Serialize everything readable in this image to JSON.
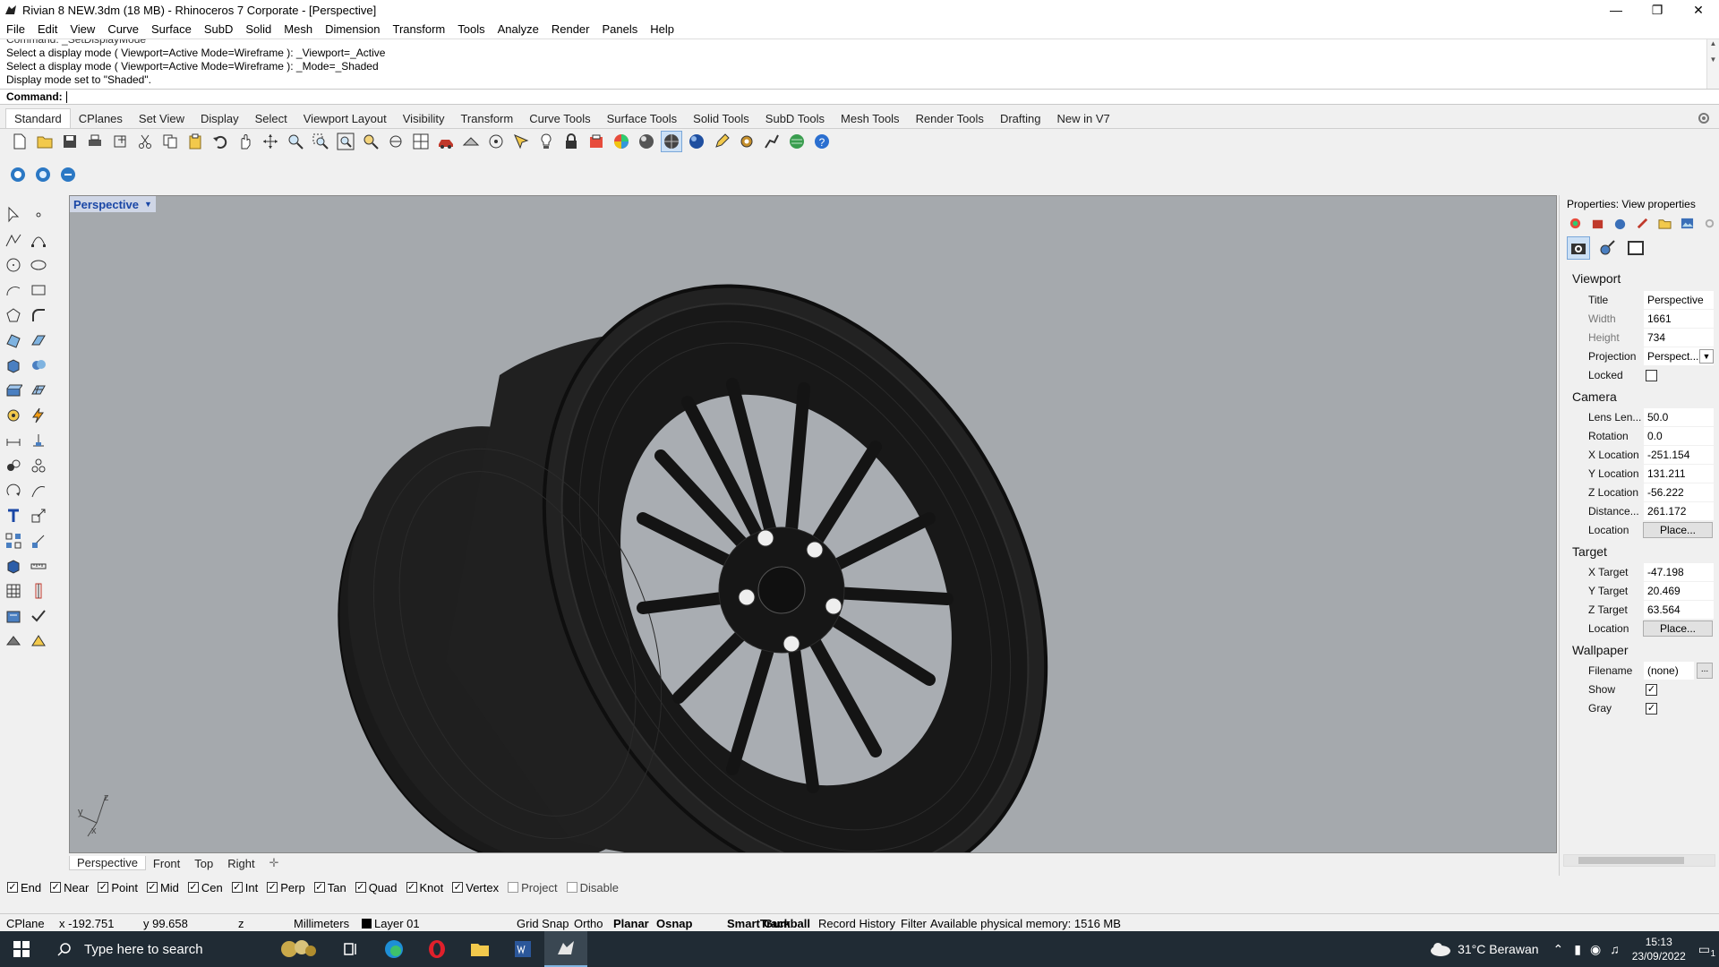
{
  "window": {
    "title": "Rivian 8 NEW.3dm (18 MB) - Rhinoceros 7 Corporate - [Perspective]"
  },
  "menu": [
    "File",
    "Edit",
    "View",
    "Curve",
    "Surface",
    "SubD",
    "Solid",
    "Mesh",
    "Dimension",
    "Transform",
    "Tools",
    "Analyze",
    "Render",
    "Panels",
    "Help"
  ],
  "command_history": [
    "Command: _SetDisplayMode",
    "Select a display mode ( Viewport=Active  Mode=Wireframe ): _Viewport=_Active",
    "Select a display mode ( Viewport=Active  Mode=Wireframe ): _Mode=_Shaded",
    "Display mode set to \"Shaded\"."
  ],
  "command_prompt": "Command:",
  "toolbar_tabs": [
    "Standard",
    "CPlanes",
    "Set View",
    "Display",
    "Select",
    "Viewport Layout",
    "Visibility",
    "Transform",
    "Curve Tools",
    "Surface Tools",
    "Solid Tools",
    "SubD Tools",
    "Mesh Tools",
    "Render Tools",
    "Drafting",
    "New in V7"
  ],
  "active_toolbar_tab": "Standard",
  "viewport": {
    "title": "Perspective",
    "axis_labels": {
      "x": "x",
      "y": "y",
      "z": "z"
    }
  },
  "view_tabs": [
    "Perspective",
    "Front",
    "Top",
    "Right"
  ],
  "active_view_tab": "Perspective",
  "osnaps": [
    {
      "label": "End",
      "checked": true
    },
    {
      "label": "Near",
      "checked": true
    },
    {
      "label": "Point",
      "checked": true
    },
    {
      "label": "Mid",
      "checked": true
    },
    {
      "label": "Cen",
      "checked": true
    },
    {
      "label": "Int",
      "checked": true
    },
    {
      "label": "Perp",
      "checked": true
    },
    {
      "label": "Tan",
      "checked": true
    },
    {
      "label": "Quad",
      "checked": true
    },
    {
      "label": "Knot",
      "checked": true
    },
    {
      "label": "Vertex",
      "checked": true
    },
    {
      "label": "Project",
      "checked": false
    },
    {
      "label": "Disable",
      "checked": false
    }
  ],
  "status": {
    "cplane": "CPlane",
    "x": "x -192.751",
    "y": "y 99.658",
    "z": "z",
    "units": "Millimeters",
    "layer": "Layer 01",
    "grid_snap": "Grid Snap",
    "ortho": "Ortho",
    "planar": "Planar",
    "osnap": "Osnap",
    "smarttrack": "SmartTrack",
    "gumball": "Gumball",
    "record_history": "Record History",
    "filter": "Filter",
    "memory": "Available physical memory: 1516 MB"
  },
  "properties": {
    "header": "Properties: View properties",
    "viewport_section": "Viewport",
    "title_label": "Title",
    "title_value": "Perspective",
    "width_label": "Width",
    "width_value": "1661",
    "height_label": "Height",
    "height_value": "734",
    "projection_label": "Projection",
    "projection_value": "Perspect...",
    "locked_label": "Locked",
    "camera_section": "Camera",
    "lens_label": "Lens Len...",
    "lens_value": "50.0",
    "rotation_label": "Rotation",
    "rotation_value": "0.0",
    "xloc_label": "X Location",
    "xloc_value": "-251.154",
    "yloc_label": "Y Location",
    "yloc_value": "131.211",
    "zloc_label": "Z Location",
    "zloc_value": "-56.222",
    "distance_label": "Distance...",
    "distance_value": "261.172",
    "location_label": "Location",
    "place_button": "Place...",
    "target_section": "Target",
    "xt_label": "X Target",
    "xt_value": "-47.198",
    "yt_label": "Y Target",
    "yt_value": "20.469",
    "zt_label": "Z Target",
    "zt_value": "63.564",
    "target_location_label": "Location",
    "wallpaper_section": "Wallpaper",
    "filename_label": "Filename",
    "filename_value": "(none)",
    "filename_button": "...",
    "show_label": "Show",
    "gray_label": "Gray"
  },
  "taskbar": {
    "search_placeholder": "Type here to search",
    "weather": "31°C  Berawan",
    "time": "15:13",
    "date": "23/09/2022",
    "notification_count": "1"
  }
}
